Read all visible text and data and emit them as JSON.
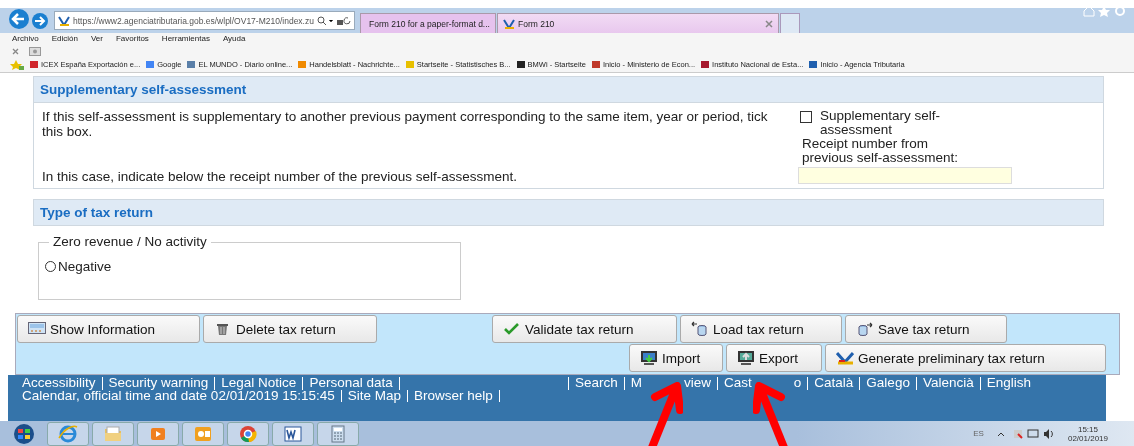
{
  "browser": {
    "address": "https://www2.agenciatributaria.gob.es/wlpl/OV17-M210/index.zu",
    "tabs": [
      {
        "title": "Form 210 for a paper-format d...",
        "selected": false
      },
      {
        "title": "Form 210",
        "selected": true
      }
    ],
    "menu": [
      "Archivo",
      "Edición",
      "Ver",
      "Favoritos",
      "Herramientas",
      "Ayuda"
    ],
    "favorites": [
      {
        "label": "ICEX España Exportación e...",
        "color": "#d0262c"
      },
      {
        "label": "Google",
        "color": "#4285f4"
      },
      {
        "label": "EL MUNDO - Diario online...",
        "color": "#5a7fa8"
      },
      {
        "label": "Handelsblatt - Nachrichte...",
        "color": "#f08a00"
      },
      {
        "label": "Startseite - Statistisches B...",
        "color": "#e8c000"
      },
      {
        "label": "BMWi - Startseite",
        "color": "#222222"
      },
      {
        "label": "Inicio - Ministerio de Econ...",
        "color": "#c0392b"
      },
      {
        "label": "Instituto Nacional de Esta...",
        "color": "#a6192e"
      },
      {
        "label": "Inicio - Agencia Tributaria",
        "color": "#1f5fae"
      }
    ]
  },
  "supplementary": {
    "title": "Supplementary self-assessment",
    "text": "If this self-assessment is supplementary to another previous payment corresponding to the same item, year or period, tick this box.",
    "hint": "In this case, indicate below the receipt number of the previous self-assessment.",
    "checkbox": {
      "label": "Supplementary self-assessment",
      "checked": false
    },
    "receipt_label": "Receipt number from previous self-assessment:"
  },
  "tax_return_type": {
    "title": "Type of tax return",
    "legend": "Zero revenue / No activity",
    "radio": {
      "label": "Negative",
      "selected": false
    }
  },
  "buttons": [
    [
      {
        "label": "Show Information",
        "kind": "info"
      },
      {
        "label": "Delete tax return",
        "kind": "trash"
      },
      {
        "label": "Validate tax return",
        "kind": "check"
      },
      {
        "label": "Load tax return",
        "kind": "load"
      },
      {
        "label": "Save tax return",
        "kind": "save"
      }
    ],
    [
      {
        "label": "Import",
        "kind": "import"
      },
      {
        "label": "Export",
        "kind": "export"
      },
      {
        "label": "Generate preliminary tax return",
        "kind": "logo"
      }
    ]
  ],
  "footer": {
    "left": [
      {
        "text": "Accessibility",
        "separator": true
      },
      {
        "text": "Security warning",
        "separator": true
      },
      {
        "text": "Legal Notice",
        "separator": true
      },
      {
        "text": "Personal data",
        "separator": true
      },
      {
        "text": "Calendar, official time and date 02/01/2019 15:15:45",
        "separator": true
      },
      {
        "text": "Site Map",
        "separator": true
      },
      {
        "text": "Browser help",
        "separator": true
      }
    ],
    "right": [
      {
        "text": "Search",
        "separator": true
      },
      {
        "text": "M",
        "separator": false
      },
      {
        "text": "view",
        "separator": true
      },
      {
        "text": "Cast",
        "separator": false
      },
      {
        "text": "o",
        "separator": true
      },
      {
        "text": "Català",
        "separator": true
      },
      {
        "text": "Galego",
        "separator": true
      },
      {
        "text": "Valencià",
        "separator": true
      },
      {
        "text": "English",
        "separator": false
      }
    ]
  },
  "taskbar": {
    "language": "ES",
    "time": "15:15",
    "date": "02/01/2019"
  }
}
